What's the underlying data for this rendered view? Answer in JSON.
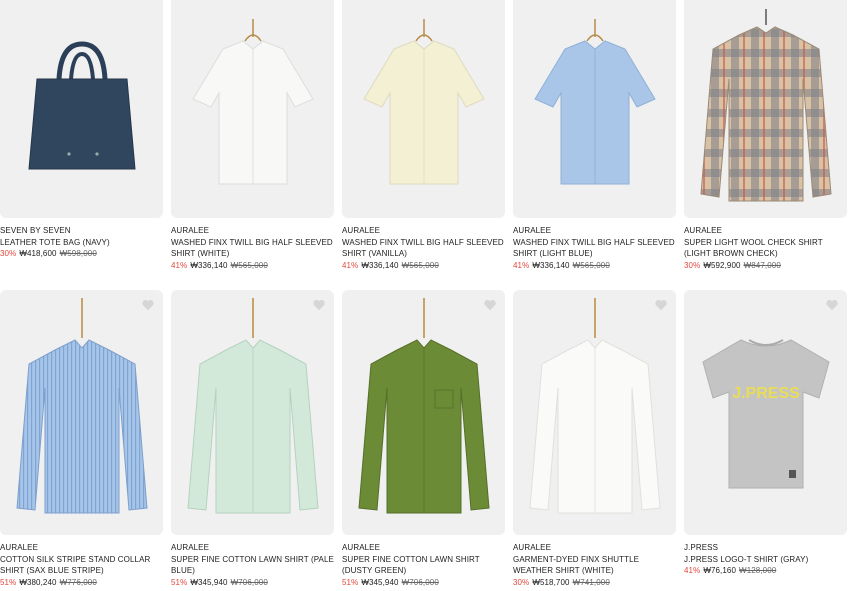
{
  "products": [
    {
      "brand": "SEVEN BY SEVEN",
      "name": "LEATHER TOTE BAG (NAVY)",
      "discount": "30%",
      "price": "₩418,600",
      "original": "₩598,000",
      "image": "tote-bag-image",
      "color": "#2f4560"
    },
    {
      "brand": "AURALEE",
      "name": "WASHED FINX TWILL BIG HALF SLEEVED SHIRT (WHITE)",
      "discount": "41%",
      "price": "₩336,140",
      "original": "₩565,000",
      "image": "white-short-sleeve-shirt-image",
      "color": "#f7f7f5"
    },
    {
      "brand": "AURALEE",
      "name": "WASHED FINX TWILL BIG HALF SLEEVED SHIRT (VANILLA)",
      "discount": "41%",
      "price": "₩336,140",
      "original": "₩565,000",
      "image": "vanilla-short-sleeve-shirt-image",
      "color": "#f3f0d2"
    },
    {
      "brand": "AURALEE",
      "name": "WASHED FINX TWILL BIG HALF SLEEVED SHIRT (LIGHT BLUE)",
      "discount": "41%",
      "price": "₩336,140",
      "original": "₩565,000",
      "image": "light-blue-short-sleeve-shirt-image",
      "color": "#a9c6e8"
    },
    {
      "brand": "AURALEE",
      "name": "SUPER LIGHT WOOL CHECK SHIRT (LIGHT BROWN CHECK)",
      "discount": "30%",
      "price": "₩592,900",
      "original": "₩847,000",
      "image": "brown-check-shirt-image",
      "color": "#b9a48a"
    },
    {
      "brand": "AURALEE",
      "name": "COTTON SILK STRIPE STAND COLLAR SHIRT (SAX BLUE STRIPE)",
      "discount": "51%",
      "price": "₩380,240",
      "original": "₩776,000",
      "image": "blue-stripe-shirt-image",
      "color": "#9fbfe3"
    },
    {
      "brand": "AURALEE",
      "name": "SUPER FINE COTTON LAWN SHIRT (PALE BLUE)",
      "discount": "51%",
      "price": "₩345,940",
      "original": "₩706,000",
      "image": "pale-blue-shirt-image",
      "color": "#cfe6d7"
    },
    {
      "brand": "AURALEE",
      "name": "SUPER FINE COTTON LAWN SHIRT (DUSTY GREEN)",
      "discount": "51%",
      "price": "₩345,940",
      "original": "₩706,000",
      "image": "dusty-green-shirt-image",
      "color": "#6a8a35"
    },
    {
      "brand": "AURALEE",
      "name": "GARMENT-DYED FINX SHUTTLE WEATHER SHIRT (WHITE)",
      "discount": "30%",
      "price": "₩518,700",
      "original": "₩741,000",
      "image": "white-weather-shirt-image",
      "color": "#f8f8f6"
    },
    {
      "brand": "J.PRESS",
      "name": "J.PRESS LOGO-T SHIRT (GRAY)",
      "discount": "41%",
      "price": "₩76,160",
      "original": "₩128,000",
      "image": "gray-logo-tshirt-image",
      "color": "#c3c3c3"
    }
  ],
  "tshirt_logo_text": "J.PRESS",
  "icons": {
    "wishlist": "heart-icon"
  },
  "colors": {
    "discount": "#e4473e",
    "image_bg": "#f0f0f0"
  }
}
